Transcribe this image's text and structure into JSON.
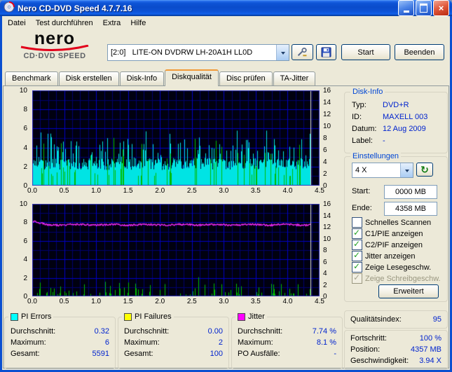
{
  "window": {
    "title": "Nero CD-DVD Speed 4.7.7.16"
  },
  "menu": {
    "items": [
      {
        "label": "Datei"
      },
      {
        "label": "Test durchführen"
      },
      {
        "label": "Extra"
      },
      {
        "label": "Hilfe"
      }
    ]
  },
  "logo": {
    "name": "nero",
    "subtitle": "CD·DVD SPEED"
  },
  "toolbar": {
    "drive_selected": "[2:0]   LITE-ON DVDRW LH-20A1H LL0D",
    "start_label": "Start",
    "quit_label": "Beenden"
  },
  "tabs": [
    {
      "label": "Benchmark",
      "active": false
    },
    {
      "label": "Disk erstellen",
      "active": false
    },
    {
      "label": "Disk-Info",
      "active": false
    },
    {
      "label": "Diskqualität",
      "active": true
    },
    {
      "label": "Disc prüfen",
      "active": false
    },
    {
      "label": "TA-Jitter",
      "active": false
    }
  ],
  "disk_info": {
    "title": "Disk-Info",
    "rows": [
      {
        "label": "Typ:",
        "value": "DVD+R"
      },
      {
        "label": "ID:",
        "value": "MAXELL 003"
      },
      {
        "label": "Datum:",
        "value": "12 Aug 2009"
      },
      {
        "label": "Label:",
        "value": "-"
      }
    ]
  },
  "settings": {
    "title": "Einstellungen",
    "speed_selected": "4 X",
    "start_label": "Start:",
    "start_value": "0000 MB",
    "end_label": "Ende:",
    "end_value": "4358 MB",
    "checkboxes": [
      {
        "label": "Schnelles Scannen",
        "checked": false,
        "enabled": true
      },
      {
        "label": "C1/PIE anzeigen",
        "checked": true,
        "enabled": true
      },
      {
        "label": "C2/PIF anzeigen",
        "checked": true,
        "enabled": true
      },
      {
        "label": "Jitter anzeigen",
        "checked": true,
        "enabled": true
      },
      {
        "label": "Zeige Lesegeschw.",
        "checked": true,
        "enabled": true
      },
      {
        "label": "Zeige Schreibgeschw.",
        "checked": true,
        "enabled": false
      }
    ],
    "advanced_label": "Erweitert"
  },
  "quality": {
    "label": "Qualitätsindex:",
    "value": "95"
  },
  "progress": {
    "rows": [
      {
        "label": "Fortschritt:",
        "value": "100 %"
      },
      {
        "label": "Position:",
        "value": "4357 MB"
      },
      {
        "label": "Geschwindigkeit:",
        "value": "3.94 X"
      }
    ]
  },
  "stats": {
    "pi_errors": {
      "title": "PI Errors",
      "legend_color": "#00FFFF",
      "rows": [
        {
          "label": "Durchschnitt:",
          "value": "0.32"
        },
        {
          "label": "Maximum:",
          "value": "6"
        },
        {
          "label": "Gesamt:",
          "value": "5591"
        }
      ]
    },
    "pi_failures": {
      "title": "PI Failures",
      "legend_color": "#FFFF00",
      "rows": [
        {
          "label": "Durchschnitt:",
          "value": "0.00"
        },
        {
          "label": "Maximum:",
          "value": "2"
        },
        {
          "label": "Gesamt:",
          "value": "100"
        }
      ]
    },
    "jitter": {
      "title": "Jitter",
      "legend_color": "#FF00FF",
      "rows": [
        {
          "label": "Durchschnitt:",
          "value": "7.74 %"
        },
        {
          "label": "Maximum:",
          "value": "8.1 %"
        },
        {
          "label": "PO Ausfälle:",
          "value": "-"
        }
      ]
    }
  },
  "chart_data": [
    {
      "name": "pi_errors_scan",
      "type": "area",
      "x_range": [
        0,
        4.5
      ],
      "x_ticks": [
        "0.0",
        "0.5",
        "1.0",
        "1.5",
        "2.0",
        "2.5",
        "3.0",
        "3.5",
        "4.0",
        "4.5"
      ],
      "y_left": {
        "range": [
          0,
          10
        ],
        "tick_step": 2
      },
      "y_right": {
        "range": [
          0,
          16
        ],
        "tick_step": 2
      },
      "grid": {
        "bg": "#000010",
        "minor": "#00006E",
        "major": "#0000C4",
        "border": "#3C3CC0",
        "minor_x_step": 0.125,
        "major_x_step": 0.5,
        "minor_y_step": 1,
        "major_y_step": 2
      },
      "scan_end_x": 4.36,
      "end_marker_color": "#E2E2E2",
      "series": [
        {
          "name": "PI Errors",
          "style": "columns",
          "color": "#00E4E4",
          "base_level": 2.5,
          "spike_max": 6,
          "stat_avg": 0.32,
          "stat_max": 6,
          "stat_total": 5591
        },
        {
          "name": "PI Failures",
          "style": "spikes",
          "color": "#00BC00",
          "density": 0.16,
          "spike_min": 1,
          "spike_max": 6.3,
          "stat_max": 2,
          "stat_total": 100
        }
      ]
    },
    {
      "name": "jitter_scan",
      "type": "line",
      "x_range": [
        0,
        4.5
      ],
      "x_ticks": [
        "0.0",
        "0.5",
        "1.0",
        "1.5",
        "2.0",
        "2.5",
        "3.0",
        "3.5",
        "4.0",
        "4.5"
      ],
      "y_left": {
        "range": [
          0,
          10
        ],
        "tick_step": 2
      },
      "y_right": {
        "range": [
          0,
          16
        ],
        "tick_step": 2
      },
      "grid": {
        "bg": "#000010",
        "minor": "#00006E",
        "major": "#0000C4",
        "border": "#3C3CC0",
        "minor_x_step": 0.125,
        "major_x_step": 0.5,
        "minor_y_step": 1,
        "major_y_step": 2
      },
      "scan_end_x": 4.36,
      "end_marker_color": "#E2E2E2",
      "series": [
        {
          "name": "PI Failures",
          "style": "spikes",
          "color": "#00BC00",
          "density": 0.22,
          "spike_min": 0.2,
          "spike_max": 2.1
        },
        {
          "name": "Jitter",
          "style": "line",
          "color": "#FF2BFF",
          "level": 7.74,
          "peak": 8.1,
          "stat_avg_pct": 7.74,
          "stat_max_pct": 8.1
        }
      ]
    }
  ]
}
